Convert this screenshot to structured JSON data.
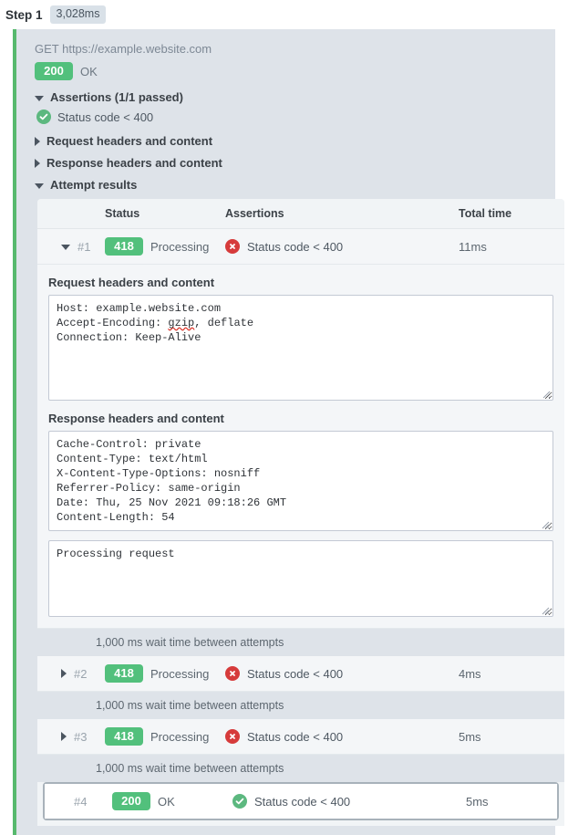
{
  "header": {
    "step_label": "Step 1",
    "duration": "3,028ms"
  },
  "step": {
    "request_line": "GET https://example.website.com",
    "status_code": "200",
    "status_text": "OK",
    "accent_color": "#57b96d",
    "badge_success_color": "#52c07c",
    "badge_fail_color": "#d63b3b"
  },
  "sections": {
    "assertions": {
      "label": "Assertions (1/1 passed)",
      "expanded": true,
      "items": [
        {
          "icon": "check-circle-icon",
          "result": "pass",
          "text": "Status code < 400"
        }
      ]
    },
    "request_headers": {
      "label": "Request headers and content",
      "expanded": false
    },
    "response_headers": {
      "label": "Response headers and content",
      "expanded": false
    },
    "attempt_results": {
      "label": "Attempt results",
      "expanded": true
    }
  },
  "attempts_table": {
    "columns": [
      "",
      "Status",
      "Assertions",
      "Total time"
    ],
    "rows": [
      {
        "index": "#1",
        "expanded": true,
        "code": "418",
        "status": "Processing",
        "assertion": "Status code < 400",
        "assertion_result": "fail",
        "total_time": "11ms",
        "selected": false
      },
      {
        "index": "#2",
        "expanded": false,
        "code": "418",
        "status": "Processing",
        "assertion": "Status code < 400",
        "assertion_result": "fail",
        "total_time": "4ms",
        "selected": false
      },
      {
        "index": "#3",
        "expanded": false,
        "code": "418",
        "status": "Processing",
        "assertion": "Status code < 400",
        "assertion_result": "fail",
        "total_time": "5ms",
        "selected": false
      },
      {
        "index": "#4",
        "expanded": false,
        "code": "200",
        "status": "OK",
        "assertion": "Status code < 400",
        "assertion_result": "pass",
        "total_time": "5ms",
        "selected": true
      }
    ],
    "wait_notice": "1,000 ms wait time between attempts"
  },
  "attempt_detail": {
    "request_title": "Request headers and content",
    "request_content_pre": "Host: example.website.com\nAccept-Encoding: ",
    "request_content_spell": "gzip",
    "request_content_post": ", deflate\nConnection: Keep-Alive",
    "response_title": "Response headers and content",
    "response_content": "Cache-Control: private\nContent-Type: text/html\nX-Content-Type-Options: nosniff\nReferrer-Policy: same-origin\nDate: Thu, 25 Nov 2021 09:18:26 GMT\nContent-Length: 54",
    "body_content": "Processing request"
  }
}
